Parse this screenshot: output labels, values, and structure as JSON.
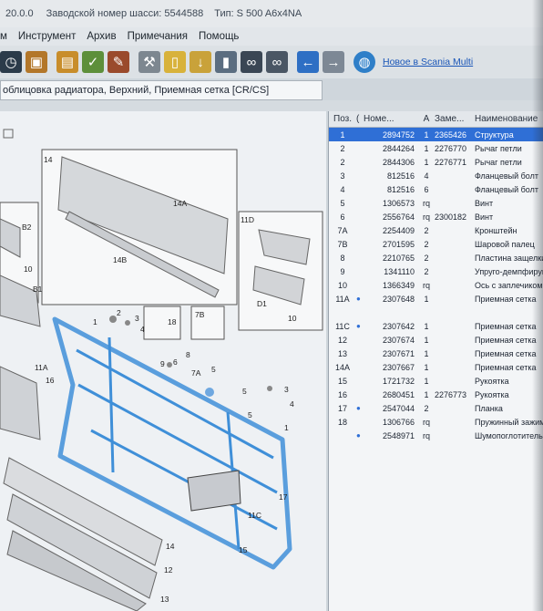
{
  "titlebar": {
    "version": "20.0.0",
    "chassis": "Заводской номер шасси: 5544588",
    "type": "Тип: S 500 A6x4NA"
  },
  "menu": [
    "м",
    "Инструмент",
    "Архив",
    "Примечания",
    "Помощь"
  ],
  "toolbar": {
    "new_link": "Новое в Scania Multi",
    "icons": [
      "clock-icon",
      "box-icon",
      "book-icon",
      "book-check-icon",
      "book-edit-icon",
      "wrench-icon",
      "document-icon",
      "arrow-down-icon",
      "bottle-icon",
      "binoculars-icon",
      "binoculars-alt-icon",
      "arrow-left-icon",
      "arrow-right-icon",
      "globe-icon"
    ]
  },
  "path": "облицовка радиатора, Верхний, Приемная сетка [CR/CS]",
  "table": {
    "headers": {
      "pos": "Поз.",
      "flag": "(",
      "no": "Номе...",
      "a": "A",
      "zam": "Заме...",
      "name": "Наименование"
    },
    "rows": [
      {
        "pos": "1",
        "no": "2894752",
        "a": "1",
        "zam": "2365426",
        "name": "Структура",
        "selected": true,
        "info": false
      },
      {
        "pos": "2",
        "no": "2844264",
        "a": "1",
        "zam": "2276770",
        "name": "Рычаг петли",
        "selected": false,
        "info": false
      },
      {
        "pos": "2",
        "no": "2844306",
        "a": "1",
        "zam": "2276771",
        "name": "Рычаг петли",
        "selected": false,
        "info": false
      },
      {
        "pos": "3",
        "no": "812516",
        "a": "4",
        "zam": "",
        "name": "Фланцевый болт",
        "selected": false,
        "info": false
      },
      {
        "pos": "4",
        "no": "812516",
        "a": "6",
        "zam": "",
        "name": "Фланцевый болт",
        "selected": false,
        "info": false
      },
      {
        "pos": "5",
        "no": "1306573",
        "a": "rq",
        "zam": "",
        "name": "Винт",
        "selected": false,
        "info": false
      },
      {
        "pos": "6",
        "no": "2556764",
        "a": "rq",
        "zam": "2300182",
        "name": "Винт",
        "selected": false,
        "info": false
      },
      {
        "pos": "7A",
        "no": "2254409",
        "a": "2",
        "zam": "",
        "name": "Кронштейн",
        "selected": false,
        "info": false
      },
      {
        "pos": "7B",
        "no": "2701595",
        "a": "2",
        "zam": "",
        "name": "Шаровой палец",
        "selected": false,
        "info": false
      },
      {
        "pos": "8",
        "no": "2210765",
        "a": "2",
        "zam": "",
        "name": "Пластина защелки",
        "selected": false,
        "info": false
      },
      {
        "pos": "9",
        "no": "1341110",
        "a": "2",
        "zam": "",
        "name": "Упруго-демпфирую",
        "selected": false,
        "info": false
      },
      {
        "pos": "10",
        "no": "1366349",
        "a": "rq",
        "zam": "",
        "name": "Ось с заплечиком",
        "selected": false,
        "info": false
      },
      {
        "pos": "11A",
        "no": "2307648",
        "a": "1",
        "zam": "",
        "name": "Приемная сетка",
        "selected": false,
        "info": true
      },
      {
        "pos": "",
        "no": "",
        "a": "",
        "zam": "",
        "name": "",
        "selected": false,
        "info": false
      },
      {
        "pos": "11C",
        "no": "2307642",
        "a": "1",
        "zam": "",
        "name": "Приемная сетка",
        "selected": false,
        "info": true
      },
      {
        "pos": "12",
        "no": "2307674",
        "a": "1",
        "zam": "",
        "name": "Приемная сетка",
        "selected": false,
        "info": false
      },
      {
        "pos": "13",
        "no": "2307671",
        "a": "1",
        "zam": "",
        "name": "Приемная сетка",
        "selected": false,
        "info": false
      },
      {
        "pos": "14A",
        "no": "2307667",
        "a": "1",
        "zam": "",
        "name": "Приемная сетка",
        "selected": false,
        "info": false
      },
      {
        "pos": "15",
        "no": "1721732",
        "a": "1",
        "zam": "",
        "name": "Рукоятка",
        "selected": false,
        "info": false
      },
      {
        "pos": "16",
        "no": "2680451",
        "a": "1",
        "zam": "2276773",
        "name": "Рукоятка",
        "selected": false,
        "info": false
      },
      {
        "pos": "17",
        "no": "2547044",
        "a": "2",
        "zam": "",
        "name": "Планка",
        "selected": false,
        "info": true
      },
      {
        "pos": "18",
        "no": "1306766",
        "a": "rq",
        "zam": "",
        "name": "Пружинный зажим",
        "selected": false,
        "info": false
      },
      {
        "pos": "",
        "no": "2548971",
        "a": "rq",
        "zam": "",
        "name": "Шумопоглотитель",
        "selected": false,
        "info": true
      }
    ]
  },
  "drawing": {
    "callouts": [
      "14",
      "14A",
      "14B",
      "B2",
      "10",
      "B1",
      "11D",
      "D1",
      "10",
      "18",
      "7B",
      "2",
      "3",
      "4",
      "1",
      "9",
      "6",
      "8",
      "7A",
      "5",
      "11A",
      "16",
      "5",
      "3",
      "4",
      "5",
      "1",
      "17",
      "11C",
      "15",
      "14",
      "12",
      "13"
    ]
  }
}
